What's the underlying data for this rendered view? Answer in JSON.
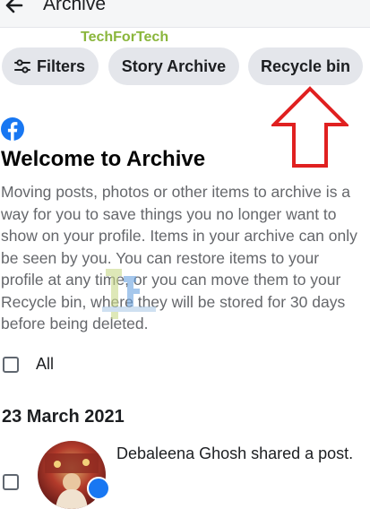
{
  "header": {
    "title": "Archive",
    "back_icon": "back-arrow-icon"
  },
  "chips": {
    "filters_label": "Filters",
    "story_archive_label": "Story Archive",
    "recycle_bin_label": "Recycle bin"
  },
  "welcome": {
    "title": "Welcome to Archive",
    "text": "Moving posts, photos or other items to archive is a\nway for you to save things you no longer want to\nshow on your profile. Items in your archive can only\nbe seen by you. You can restore items to your\nprofile at any time, or you can move them to your\nRecycle bin, where they will be stored for 30 days\nbefore being deleted."
  },
  "watermark": {
    "text": "TechForTech"
  },
  "select_all": {
    "label": "All",
    "checked": false
  },
  "sections": [
    {
      "date": "23 March 2021",
      "items": [
        {
          "text": "Debaleena Ghosh shared a post.",
          "verified": true,
          "checked": false
        }
      ]
    }
  ],
  "colors": {
    "accent": "#1877f2",
    "chip_bg": "#e4e6eb",
    "annotation_arrow": "#e02020",
    "body_text": "#65676b"
  }
}
